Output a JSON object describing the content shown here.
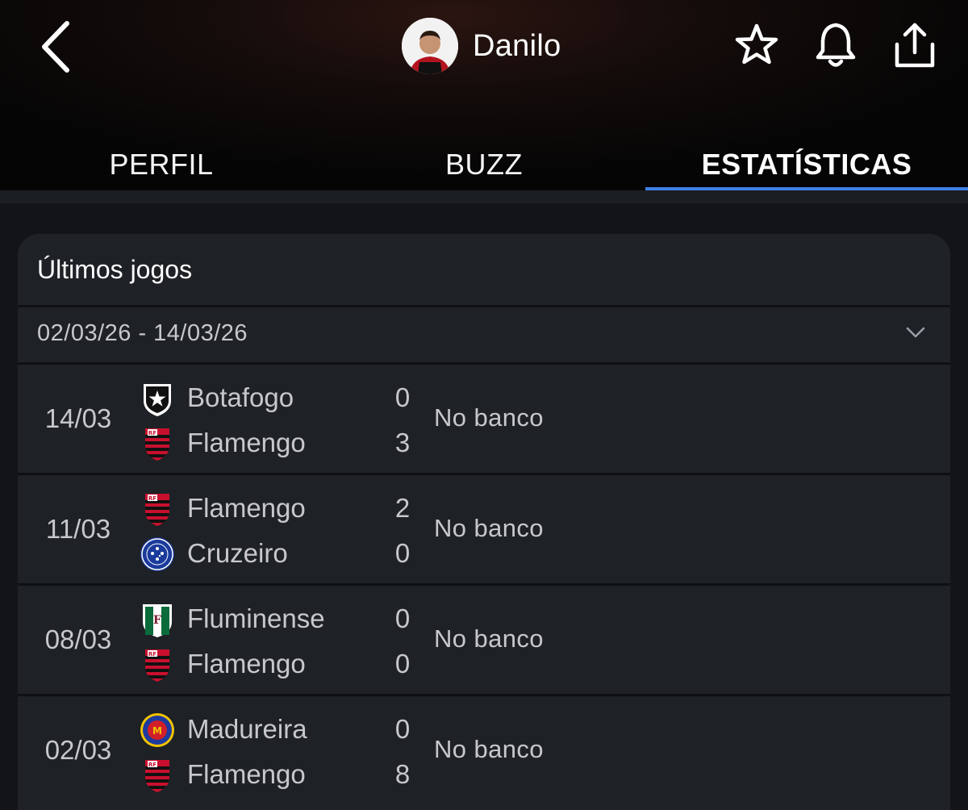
{
  "header": {
    "player_name": "Danilo",
    "icons": [
      "chevron-left-icon",
      "star-icon",
      "bell-icon",
      "share-icon"
    ]
  },
  "tabs": [
    {
      "label": "PERFIL",
      "active": false
    },
    {
      "label": "BUZZ",
      "active": false
    },
    {
      "label": "ESTATÍSTICAS",
      "active": true
    }
  ],
  "colors": {
    "accent": "#3f7fe6",
    "background": "#121418",
    "card": "#1e2226",
    "flamengo_red": "#c8102e"
  },
  "card": {
    "title": "Últimos jogos",
    "date_range": "02/03/26 - 14/03/26"
  },
  "matches": [
    {
      "date": "14/03",
      "status": "No banco",
      "home": {
        "name": "Botafogo",
        "score": "0",
        "crest": "botafogo-crest-icon"
      },
      "away": {
        "name": "Flamengo",
        "score": "3",
        "crest": "flamengo-crest-icon"
      }
    },
    {
      "date": "11/03",
      "status": "No banco",
      "home": {
        "name": "Flamengo",
        "score": "2",
        "crest": "flamengo-crest-icon"
      },
      "away": {
        "name": "Cruzeiro",
        "score": "0",
        "crest": "cruzeiro-crest-icon"
      }
    },
    {
      "date": "08/03",
      "status": "No banco",
      "home": {
        "name": "Fluminense",
        "score": "0",
        "crest": "fluminense-crest-icon"
      },
      "away": {
        "name": "Flamengo",
        "score": "0",
        "crest": "flamengo-crest-icon"
      }
    },
    {
      "date": "02/03",
      "status": "No banco",
      "home": {
        "name": "Madureira",
        "score": "0",
        "crest": "madureira-crest-icon"
      },
      "away": {
        "name": "Flamengo",
        "score": "8",
        "crest": "flamengo-crest-icon"
      }
    }
  ]
}
